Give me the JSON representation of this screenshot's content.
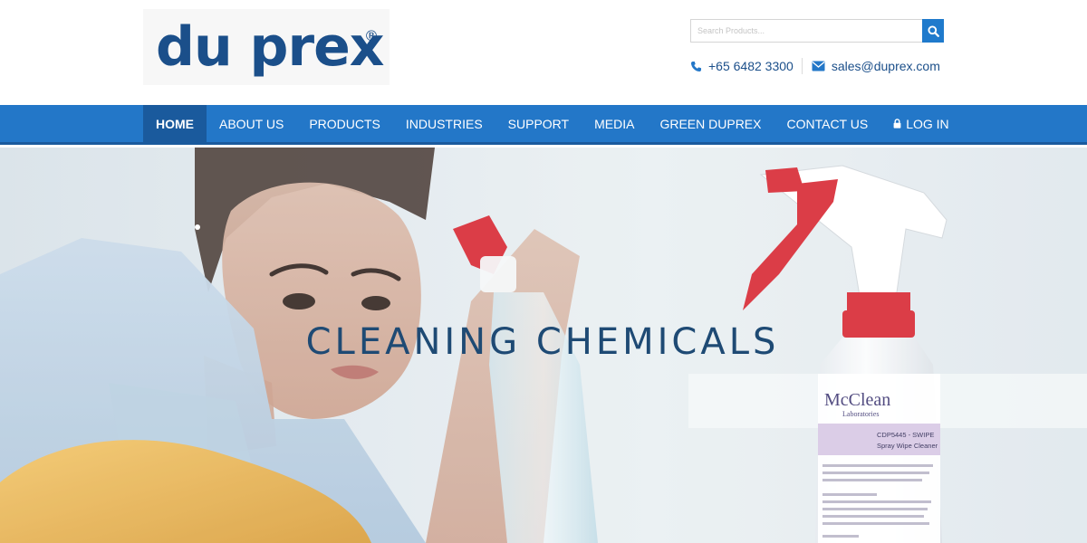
{
  "header": {
    "logo_text": "du prex",
    "logo_mark": "®",
    "search": {
      "placeholder": "Search Products...",
      "button_icon": "search-icon"
    },
    "phone": {
      "icon": "phone-icon",
      "text": "+65 6482 3300"
    },
    "email": {
      "icon": "envelope-icon",
      "text": "sales@duprex.com"
    }
  },
  "nav": {
    "items": [
      {
        "label": "Home",
        "active": true
      },
      {
        "label": "About Us"
      },
      {
        "label": "Products"
      },
      {
        "label": "Industries"
      },
      {
        "label": "Support"
      },
      {
        "label": "Media"
      },
      {
        "label": "Green Duprex"
      },
      {
        "label": "Contact Us"
      },
      {
        "label": "Log In",
        "icon": "lock-icon"
      }
    ]
  },
  "hero": {
    "title": "CLEANING CHEMICALS",
    "bottle": {
      "brand": "McClean",
      "brand_sub": "Laboratories",
      "product_code": "CDP5445 - SWIPE",
      "product_name": "Spray Wipe Cleaner"
    }
  },
  "colors": {
    "brand_blue": "#1b4f8a",
    "nav_blue": "#2377c8",
    "nav_active": "#1a5a9d",
    "trigger_red": "#d7232e"
  }
}
